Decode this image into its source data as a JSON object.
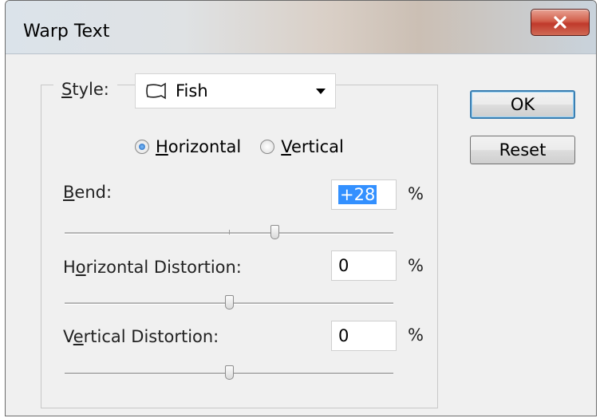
{
  "window": {
    "title": "Warp Text",
    "close_icon": "close-icon"
  },
  "style": {
    "label": "Style:",
    "value": "Fish",
    "icon": "fish-warp-icon"
  },
  "orientation": {
    "options": [
      {
        "label": "Horizontal",
        "selected": true
      },
      {
        "label": "Vertical",
        "selected": false
      }
    ]
  },
  "bend": {
    "label": "Bend:",
    "value": "+28",
    "unit": "%",
    "percent": 28
  },
  "horizontal_distortion": {
    "label": "Horizontal Distortion:",
    "value": "0",
    "unit": "%",
    "percent": 0
  },
  "vertical_distortion": {
    "label": "Vertical Distortion:",
    "value": "0",
    "unit": "%",
    "percent": 0
  },
  "buttons": {
    "ok": "OK",
    "reset": "Reset"
  },
  "colors": {
    "close_button": "#c0392b",
    "selection": "#3390ff",
    "radio_selected": "#1e5fb3"
  }
}
